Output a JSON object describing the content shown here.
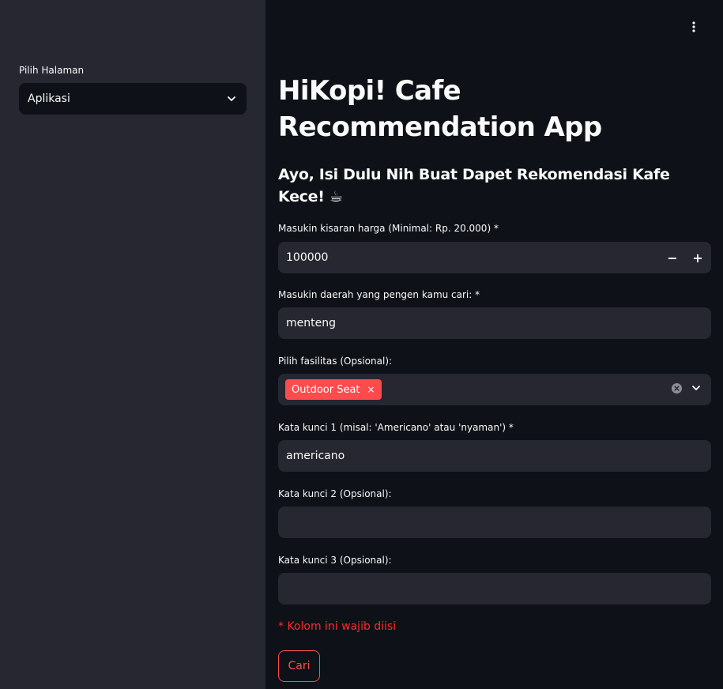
{
  "sidebar": {
    "page_select_label": "Pilih Halaman",
    "page_select_value": "Aplikasi"
  },
  "main": {
    "title": "HiKopi! Cafe Recommendation App",
    "subtitle": "Ayo, Isi Dulu Nih Buat Dapet Rekomendasi Kafe Kece! ☕",
    "price": {
      "label": "Masukin kisaran harga (Minimal: Rp. 20.000) *",
      "value": "100000",
      "minus": "−",
      "plus": "+"
    },
    "area": {
      "label": "Masukin daerah yang pengen kamu cari: *",
      "value": "menteng"
    },
    "facilities": {
      "label": "Pilih fasilitas (Opsional):",
      "selected": [
        "Outdoor Seat"
      ],
      "remove_glyph": "×"
    },
    "keyword1": {
      "label": "Kata kunci 1 (misal: 'Americano' atau 'nyaman') *",
      "value": "americano"
    },
    "keyword2": {
      "label": "Kata kunci 2 (Opsional):",
      "value": ""
    },
    "keyword3": {
      "label": "Kata kunci 3 (Opsional):",
      "value": ""
    },
    "required_note": "* Kolom ini wajib diisi",
    "search_button": "Cari"
  },
  "colors": {
    "accent": "#ff4b4b",
    "sidebar_bg": "#262730",
    "main_bg": "#0e1117",
    "input_bg": "#262730",
    "required_text": "#ff2b2b"
  }
}
